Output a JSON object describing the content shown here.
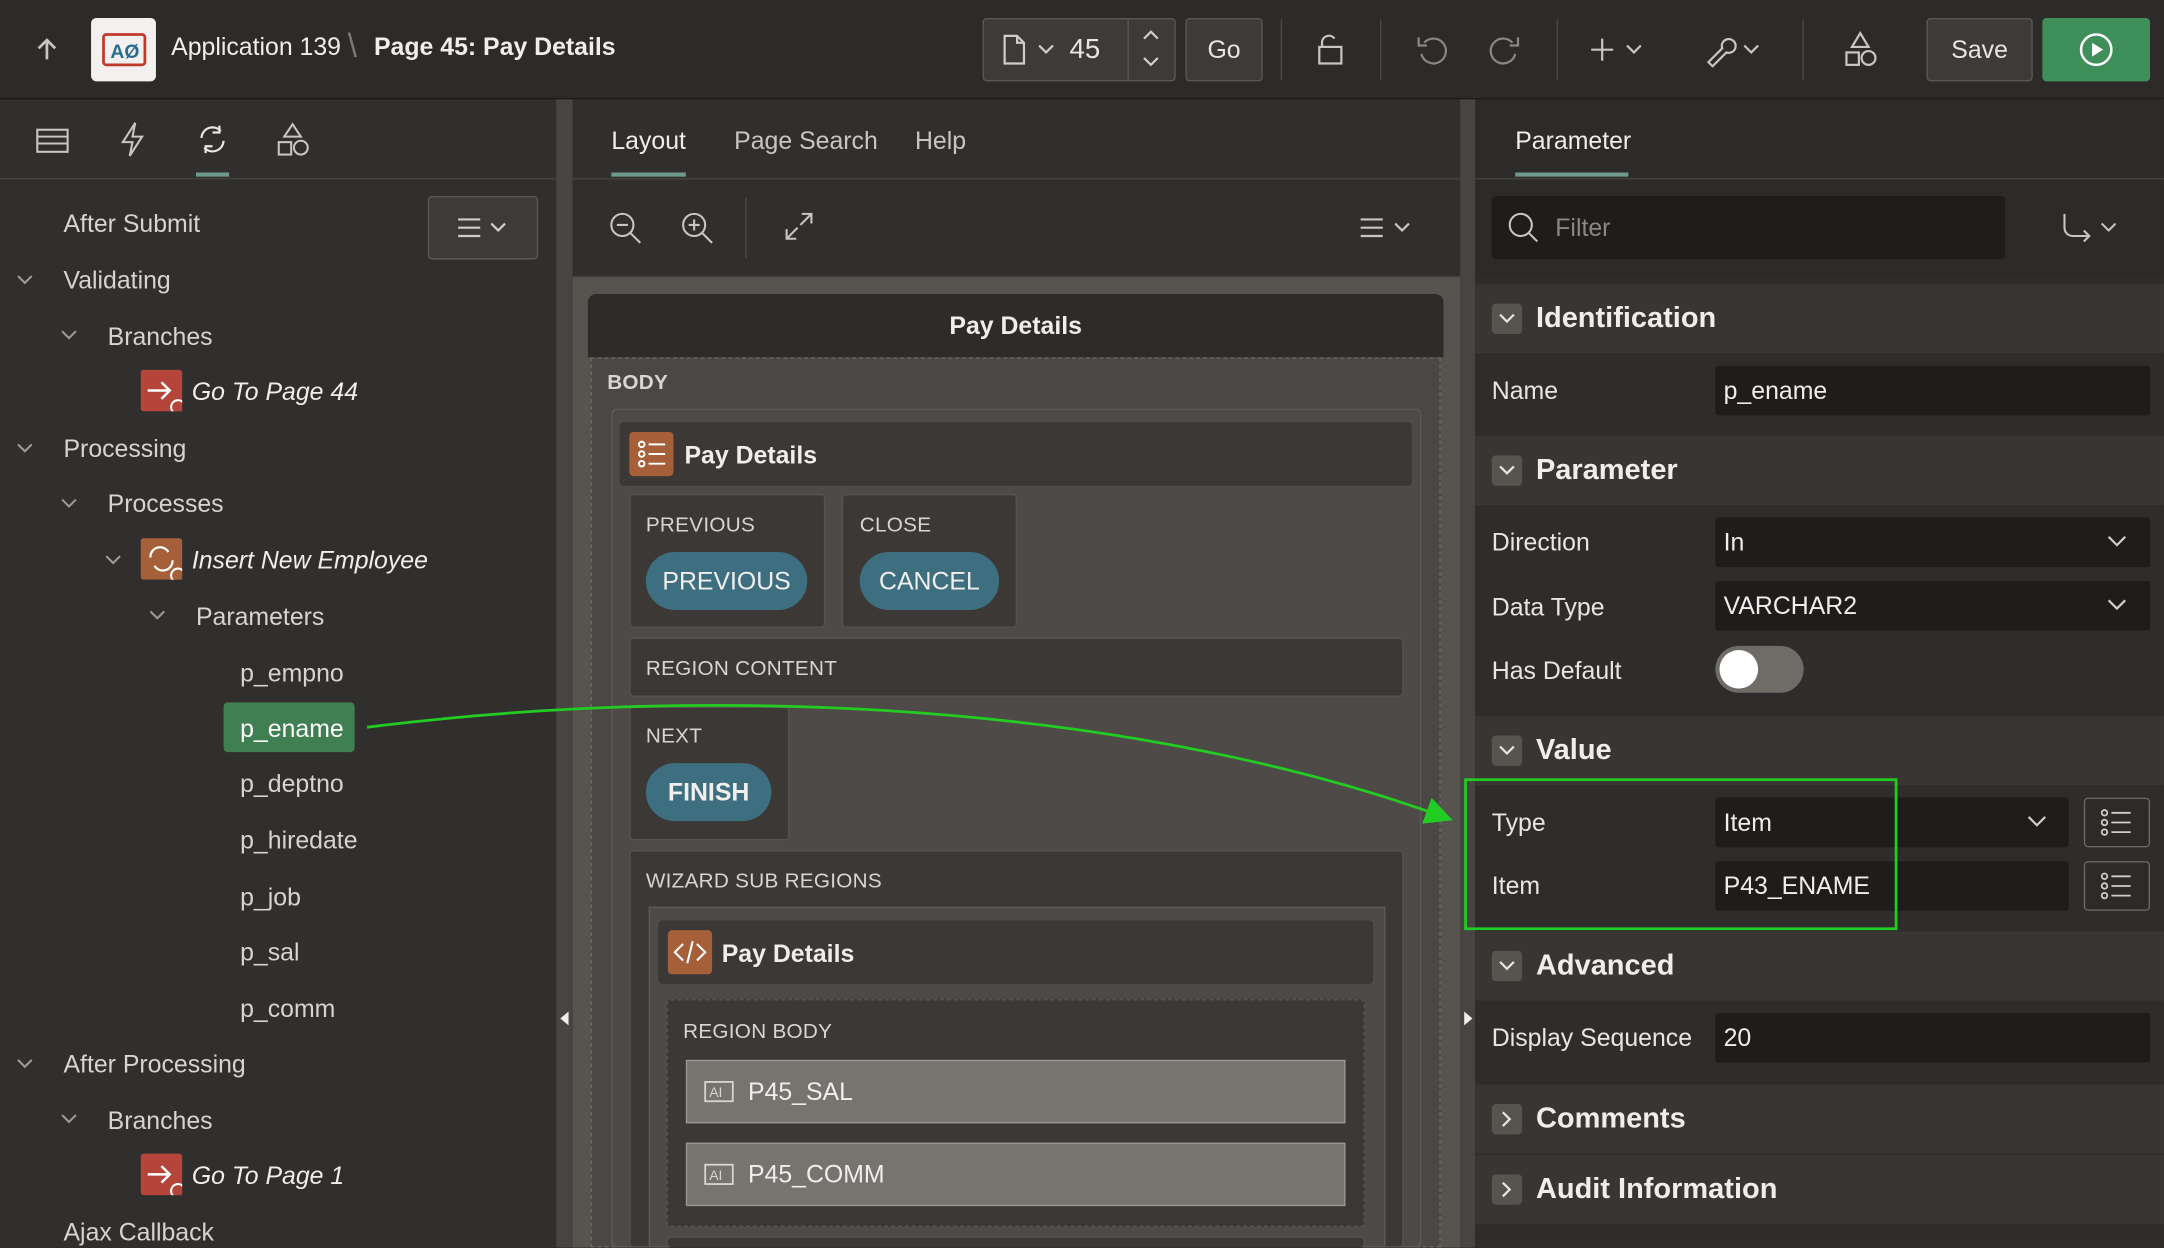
{
  "toolbar": {
    "app_name": "Application 139",
    "page_title": "Page 45: Pay Details",
    "page_number": "45",
    "go_label": "Go",
    "save_label": "Save"
  },
  "left": {
    "tabs": [
      "rendering-icon",
      "dynamic-actions-icon",
      "processing-icon",
      "shared-components-icon"
    ],
    "after_submit": "After Submit",
    "validating": "Validating",
    "branches1": "Branches",
    "go_to_44": "Go To Page 44",
    "processing": "Processing",
    "processes": "Processes",
    "insert_employee": "Insert New Employee",
    "parameters": "Parameters",
    "params": [
      "p_empno",
      "p_ename",
      "p_deptno",
      "p_hiredate",
      "p_job",
      "p_sal",
      "p_comm"
    ],
    "selected_param": "p_ename",
    "after_processing": "After Processing",
    "branches2": "Branches",
    "go_to_1": "Go To Page 1",
    "ajax_callback": "Ajax Callback"
  },
  "middle": {
    "tabs": [
      "Layout",
      "Page Search",
      "Help"
    ],
    "active_tab": "Layout",
    "page_region": "Pay Details",
    "body_label": "BODY",
    "wizard_region": "Pay Details",
    "previous_slot": "PREVIOUS",
    "previous_btn": "PREVIOUS",
    "close_slot": "CLOSE",
    "cancel_btn": "CANCEL",
    "region_content": "REGION CONTENT",
    "next_slot": "NEXT",
    "finish_btn": "FINISH",
    "wizard_sub": "WIZARD SUB REGIONS",
    "sub_region": "Pay Details",
    "region_body": "REGION BODY",
    "items": [
      "P45_SAL",
      "P45_COMM"
    ]
  },
  "right": {
    "tab": "Parameter",
    "filter_placeholder": "Filter",
    "identification": "Identification",
    "name_label": "Name",
    "name_value": "p_ename",
    "parameter": "Parameter",
    "direction_label": "Direction",
    "direction_value": "In",
    "datatype_label": "Data Type",
    "datatype_value": "VARCHAR2",
    "hasdefault_label": "Has Default",
    "value": "Value",
    "type_label": "Type",
    "type_value": "Item",
    "item_label": "Item",
    "item_value": "P43_ENAME",
    "advanced": "Advanced",
    "seq_label": "Display Sequence",
    "seq_value": "20",
    "comments": "Comments",
    "audit": "Audit Information"
  },
  "colors": {
    "highlight": "#3f7f52",
    "annotation": "#22cc22",
    "run_button": "#3f8f5a",
    "wizard_button": "#3e6f80"
  }
}
